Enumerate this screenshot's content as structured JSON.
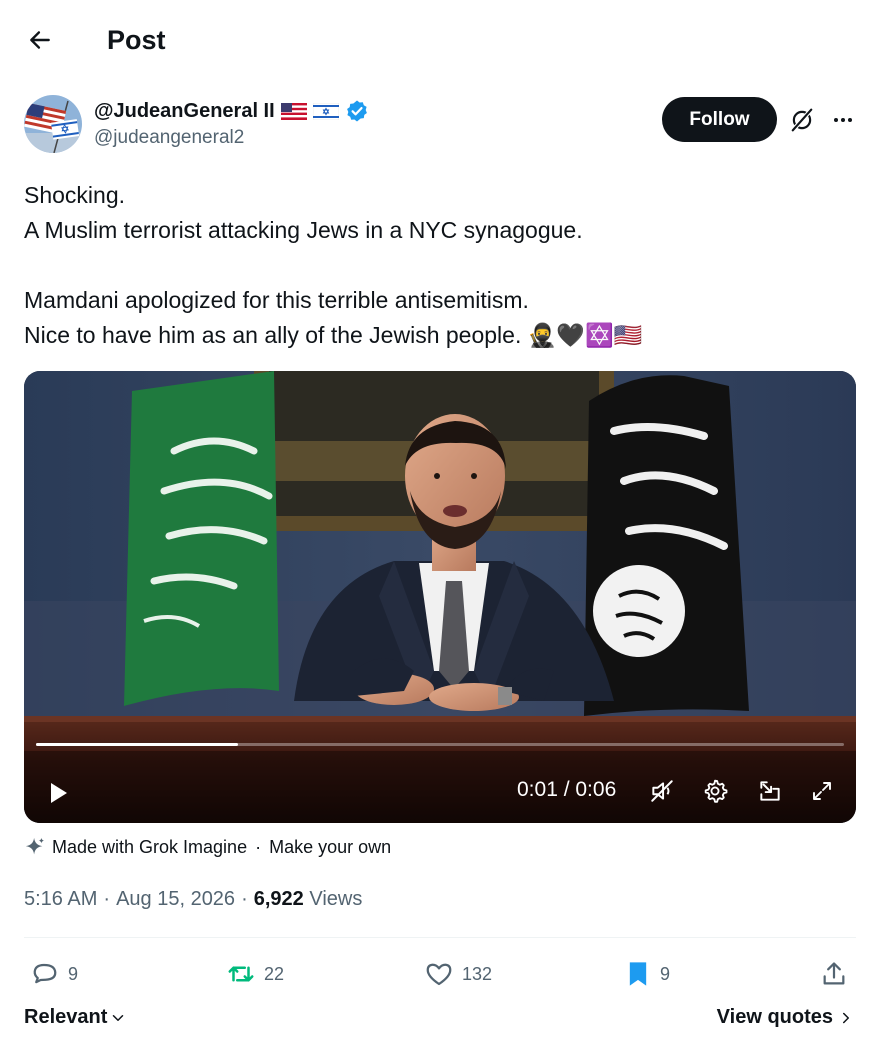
{
  "header": {
    "title": "Post"
  },
  "author": {
    "display_name": "@JudeanGeneral II",
    "handle": "@judeangeneral2",
    "verified": true
  },
  "follow_label": "Follow",
  "tweet": {
    "lines": [
      "Shocking.",
      "A Muslim terrorist attacking Jews in a NYC synagogue.",
      "",
      "Mamdani apologized for this terrible antisemitism.",
      "Nice to have him as an ally of the Jewish people. 🥷🖤✡️🇺🇸"
    ]
  },
  "video": {
    "time": "0:01 / 0:06",
    "progress": 0.25,
    "muted": true
  },
  "grok_note": {
    "made_with": "Made with Grok Imagine",
    "separator": "·",
    "make_your_own": "Make your own"
  },
  "meta": {
    "time": "5:16 AM",
    "dot1": "·",
    "date": "Aug 15, 2026",
    "dot2": "·",
    "views_count": "6,922",
    "views_label": "Views"
  },
  "actions": {
    "replies": "9",
    "reposts": "22",
    "likes": "132",
    "bookmarks": "9"
  },
  "colors": {
    "repost_green": "#00ba7c",
    "bookmark_blue": "#1d9bf0",
    "verified_blue": "#1d9bf0",
    "secondary_text": "#536471"
  },
  "footer": {
    "relevant_label": "Relevant",
    "view_quotes_label": "View quotes"
  }
}
